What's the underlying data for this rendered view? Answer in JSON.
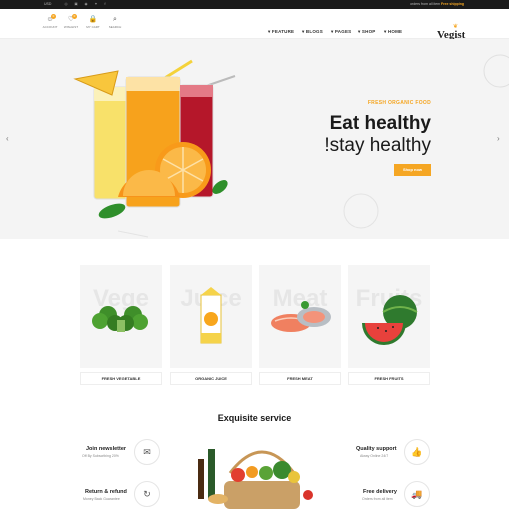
{
  "topbar": {
    "lang": "USD",
    "social_icons": [
      "instagram-icon",
      "facebook-icon",
      "twitter-icon",
      "pinterest-icon",
      "google-icon"
    ],
    "shipping_text": "orders from all item",
    "shipping_highlight": "Free shipping"
  },
  "header": {
    "icons": [
      {
        "glyph": "☺",
        "label": "ACCOUNT"
      },
      {
        "glyph": "♡",
        "label": "WISHLIST"
      },
      {
        "glyph": "🔒",
        "label": "MY CART"
      },
      {
        "glyph": "⌕",
        "label": "SEARCH"
      }
    ],
    "nav": [
      "FEATURE",
      "BLOGS",
      "PAGES",
      "SHOP",
      "HOME"
    ],
    "logo": "Vegist",
    "accent": "#f5a623"
  },
  "hero": {
    "subtitle": "FRESH ORGANIC FOOD",
    "title_line1": "Eat healthy",
    "title_line2": "!stay healthy",
    "button": "Shop now",
    "prev": "‹",
    "next": "›"
  },
  "categories": [
    {
      "label": "FRESH VEGETABLE",
      "ghost": "Vege"
    },
    {
      "label": "ORGANIC JUICE",
      "ghost": "Juice"
    },
    {
      "label": "FRESH MEAT",
      "ghost": "Meat"
    },
    {
      "label": "FRESH FRUITS",
      "ghost": "Fruits"
    }
  ],
  "services": {
    "title": "Exquisite service",
    "items": [
      {
        "title": "Join newsletter",
        "sub": "Off By Subscribing 20%",
        "icon": "✉"
      },
      {
        "title": "Return & refund",
        "sub": "Money Back Guarantee",
        "icon": "↻"
      },
      {
        "title": "Quality support",
        "sub": "Alway Online 24/7",
        "icon": "👍"
      },
      {
        "title": "Free delivery",
        "sub": "Orders from all item",
        "icon": "🚚"
      }
    ]
  }
}
